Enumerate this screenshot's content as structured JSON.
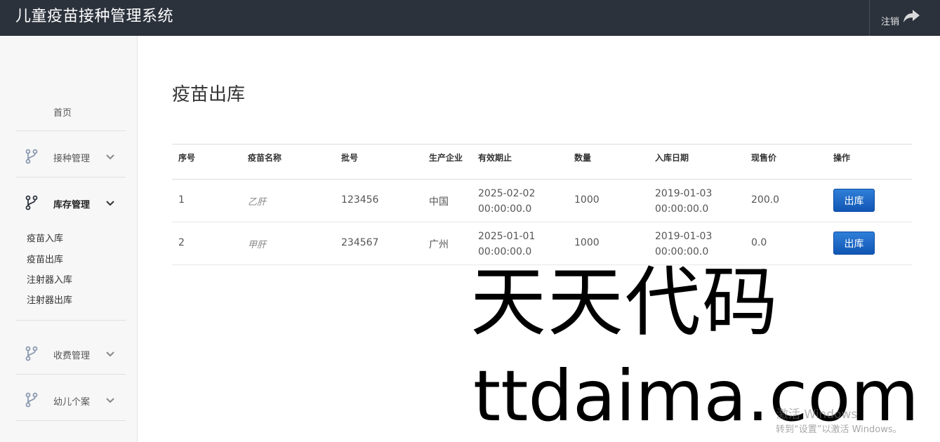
{
  "header": {
    "app_title": "儿童疫苗接种管理系统",
    "logout_label": "注销",
    "logout_icon": "share-arrow-icon"
  },
  "sidebar": {
    "home": "首页",
    "menus": [
      {
        "label": "接种管理",
        "icon": "branch-icon",
        "expanded": false
      },
      {
        "label": "库存管理",
        "icon": "branch-icon",
        "expanded": true,
        "sub_items": [
          "疫苗入库",
          "疫苗出库",
          "注射器入库",
          "注射器出库"
        ]
      },
      {
        "label": "收费管理",
        "icon": "branch-icon",
        "expanded": false
      },
      {
        "label": "幼儿个案",
        "icon": "branch-icon",
        "expanded": false
      }
    ]
  },
  "main": {
    "page_title": "疫苗出库",
    "table": {
      "headers": [
        "序号",
        "疫苗名称",
        "批号",
        "生产企业",
        "有效期止",
        "数量",
        "入库日期",
        "现售价",
        "操作"
      ],
      "rows": [
        {
          "seq": "1",
          "name": "乙肝",
          "batch": "123456",
          "maker": "中国",
          "expiry_date": "2025-02-02",
          "expiry_time": "00:00:00.0",
          "qty": "1000",
          "in_date": "2019-01-03",
          "in_time": "00:00:00.0",
          "price": "200.0",
          "action": "出库"
        },
        {
          "seq": "2",
          "name": "甲肝",
          "batch": "234567",
          "maker": "广州",
          "expiry_date": "2025-01-01",
          "expiry_time": "00:00:00.0",
          "qty": "1000",
          "in_date": "2019-01-03",
          "in_time": "00:00:00.0",
          "price": "0.0",
          "action": "出库"
        }
      ]
    }
  },
  "overlay": {
    "watermark_cn": "天天代码",
    "watermark_en": "ttdaima.com",
    "activate_line1": "激活 Windows",
    "activate_line2": "转到“设置”以激活 Windows。"
  },
  "colors": {
    "topbar": "#2b323c",
    "button_primary": "#1a64c4",
    "sidebar_bg": "#f7f7f7"
  }
}
